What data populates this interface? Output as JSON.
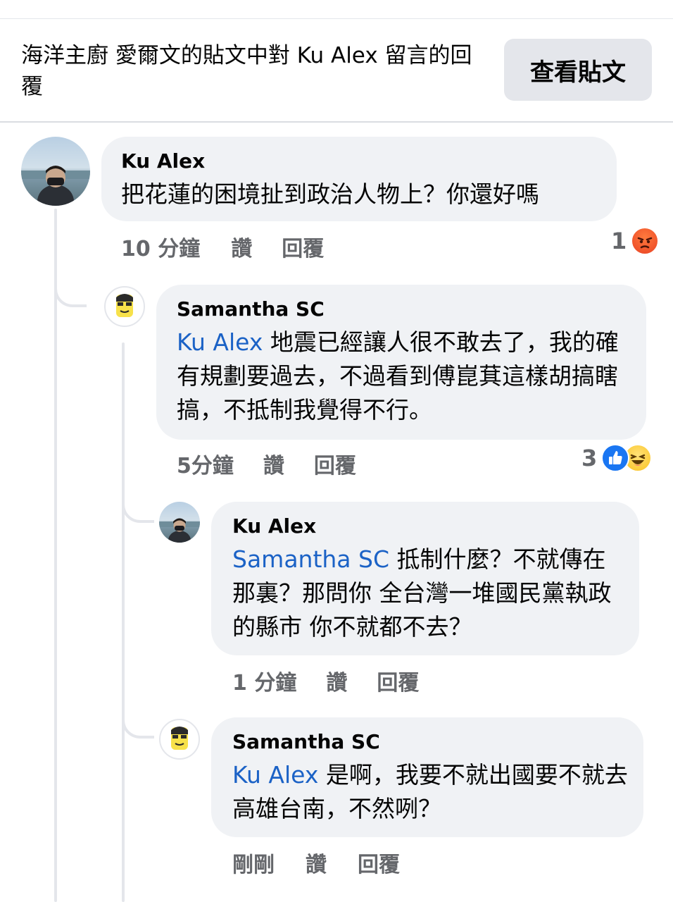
{
  "header": {
    "title": "海洋主廚 愛爾文的貼文中對 Ku Alex 留言的回覆",
    "view_post_label": "查看貼文"
  },
  "comments": [
    {
      "author": "Ku Alex",
      "mention": "",
      "text": "把花蓮的困境扯到政治人物上？你還好嗎",
      "time": "10 分鐘",
      "like_label": "讚",
      "reply_label": "回覆",
      "reaction_count": "1",
      "reactions": [
        "angry-emoji-icon"
      ]
    },
    {
      "author": "Samantha SC",
      "mention": "Ku Alex",
      "text": " 地震已經讓人很不敢去了，我的確有規劃要過去，不過看到傅崑萁這樣胡搞瞎搞，不抵制我覺得不行。",
      "time": "5分鐘",
      "like_label": "讚",
      "reply_label": "回覆",
      "reaction_count": "3",
      "reactions": [
        "like-icon",
        "haha-emoji-icon"
      ]
    },
    {
      "author": "Ku Alex",
      "mention": "Samantha SC",
      "text": " 抵制什麼？不就傳在那裏？那問你 全台灣一堆國民黨執政的縣市 你不就都不去？",
      "time": "1 分鐘",
      "like_label": "讚",
      "reply_label": "回覆"
    },
    {
      "author": "Samantha SC",
      "mention": "Ku Alex",
      "text": " 是啊，我要不就出國要不就去高雄台南，不然咧？",
      "time": "剛剛",
      "like_label": "讚",
      "reply_label": "回覆"
    }
  ],
  "colors": {
    "mention": "#1b62c6",
    "bubble": "#f0f2f5",
    "meta": "#65676b",
    "like": "#1a76f2",
    "angry": "#f0532b",
    "haha": "#fccc3b"
  }
}
